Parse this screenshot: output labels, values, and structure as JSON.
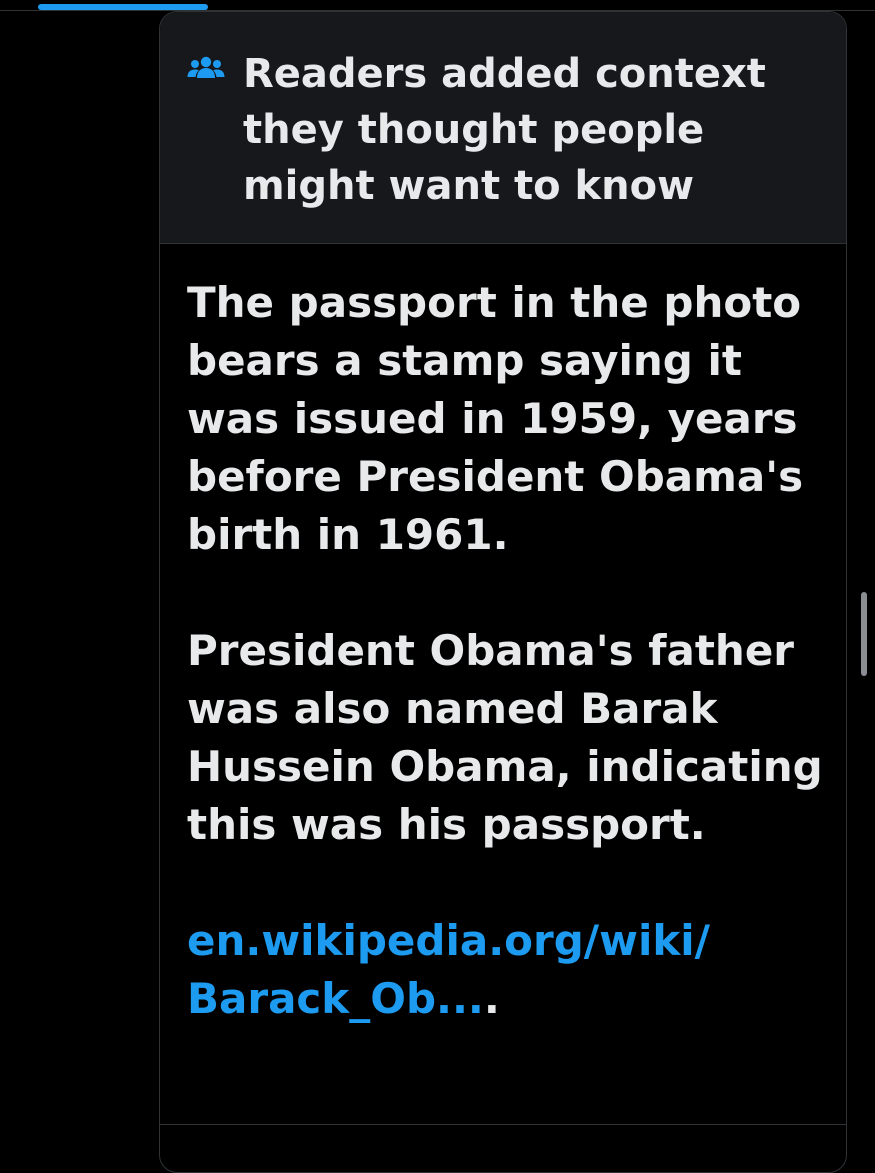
{
  "note": {
    "title": "Readers added context they thought people might want to know",
    "header_icon": "people-icon",
    "paragraph_1": "The passport in the photo bears a stamp saying it was issued in 1959, years before President Obama's birth in 1961.",
    "paragraph_2": "President Obama's father was also named Barak Hussein Obama, indicating this was his passport.",
    "link_line_1": "en.wikipedia.org/wiki/",
    "link_line_2": "Barack_Ob...",
    "link_suffix": "."
  },
  "colors": {
    "background": "#000000",
    "header_background": "#16181c",
    "text": "#e7e9ea",
    "accent": "#1d9bf0",
    "border": "#2f3336"
  }
}
